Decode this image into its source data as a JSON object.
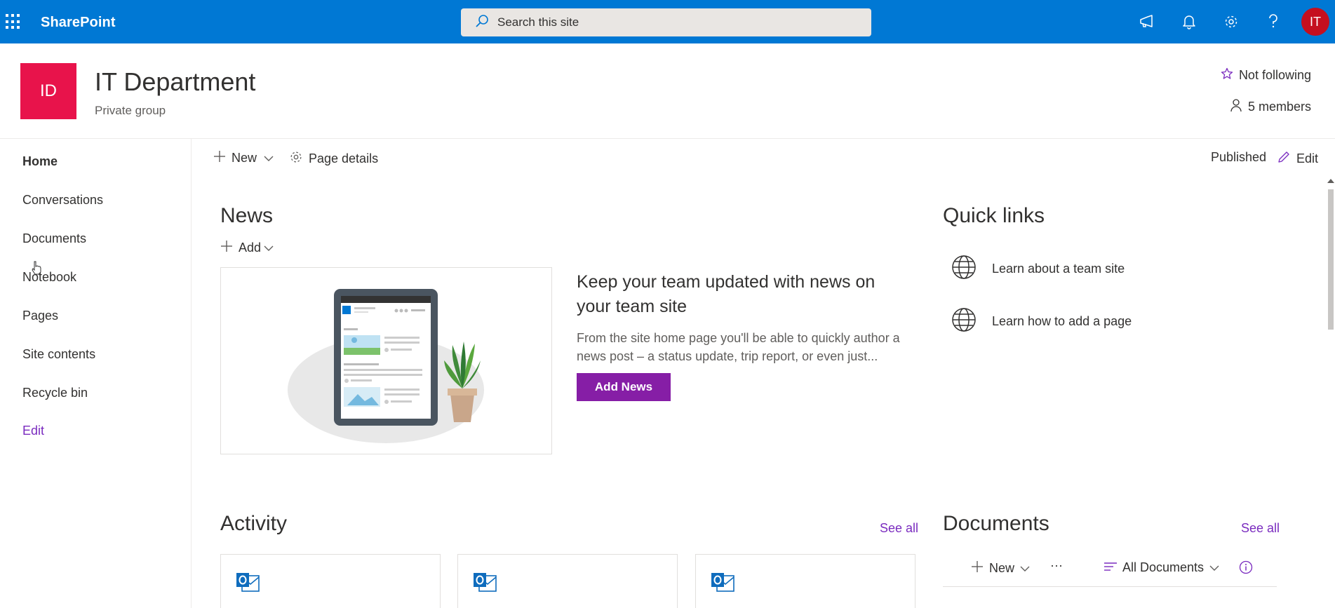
{
  "suitebar": {
    "brand": "SharePoint",
    "search_placeholder": "Search this site",
    "avatar_initials": "IT",
    "icons": [
      "megaphone-icon",
      "bell-icon",
      "gear-icon",
      "help-icon"
    ]
  },
  "site": {
    "logo_initials": "ID",
    "title": "IT Department",
    "subtitle": "Private group",
    "follow_label": "Not following",
    "members_label": "5 members"
  },
  "nav": {
    "items": [
      "Home",
      "Conversations",
      "Documents",
      "Notebook",
      "Pages",
      "Site contents",
      "Recycle bin"
    ],
    "edit_label": "Edit"
  },
  "commandbar": {
    "new_label": "New",
    "page_details_label": "Page details",
    "status_label": "Published",
    "edit_label": "Edit"
  },
  "news": {
    "title": "News",
    "add_label": "Add",
    "headline": "Keep your team updated with news on your team site",
    "body": "From the site home page you'll be able to quickly author a news post – a status update, trip report, or even just...",
    "button_label": "Add News"
  },
  "quicklinks": {
    "title": "Quick links",
    "items": [
      "Learn about a team site",
      "Learn how to add a page"
    ]
  },
  "activity": {
    "title": "Activity",
    "see_all": "See all"
  },
  "documents": {
    "title": "Documents",
    "see_all": "See all",
    "new_label": "New",
    "more_label": "···",
    "view_label": "All Documents"
  },
  "colors": {
    "suitebar": "#0078d4",
    "accent": "#861ea6",
    "link": "#7a2bbf",
    "site_logo": "#e8134b",
    "avatar": "#c50f1f"
  }
}
